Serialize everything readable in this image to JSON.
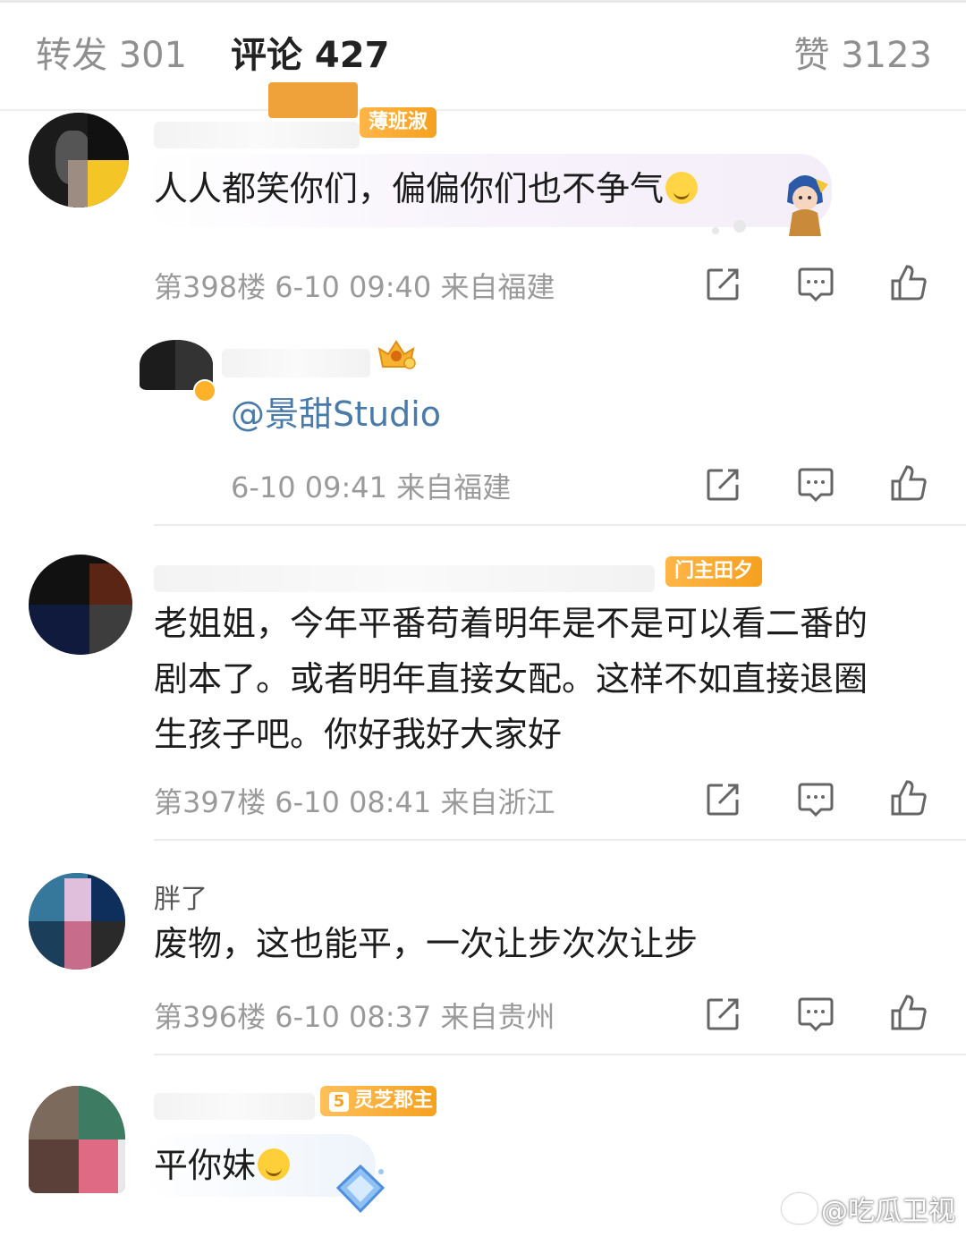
{
  "tabs": {
    "repost": "转发 301",
    "comment": "评论 427",
    "like": "赞 3123"
  },
  "comments": [
    {
      "badge": "薄班淑",
      "text": "人人都笑你们，偏偏你们也不争气",
      "emoji": "smile-emoji",
      "meta": "第398楼 6-10 09:40 来自福建"
    },
    {
      "reply_text": "@景甜Studio",
      "meta": "6-10 09:41 来自福建"
    },
    {
      "badge": "门主田夕",
      "text_lines": [
        "老姐姐，今年平番苟着明年是不是可以看二番的",
        "剧本了。或者明年直接女配。这样不如直接退圈",
        "生孩子吧。你好我好大家好"
      ],
      "meta": "第397楼 6-10 08:41 来自浙江"
    },
    {
      "name": "胖了",
      "text": "废物，这也能平，一次让步次次让步",
      "meta": "第396楼 6-10 08:37 来自贵州"
    },
    {
      "level": "5",
      "badge": "灵芝郡主",
      "text": "平你妹",
      "emoji": "laugh-emoji"
    }
  ],
  "actions": {
    "share_icon": "share-icon",
    "comment_icon": "comment-icon",
    "like_icon": "thumbs-up-icon"
  },
  "watermark": "@吃瓜卫视"
}
